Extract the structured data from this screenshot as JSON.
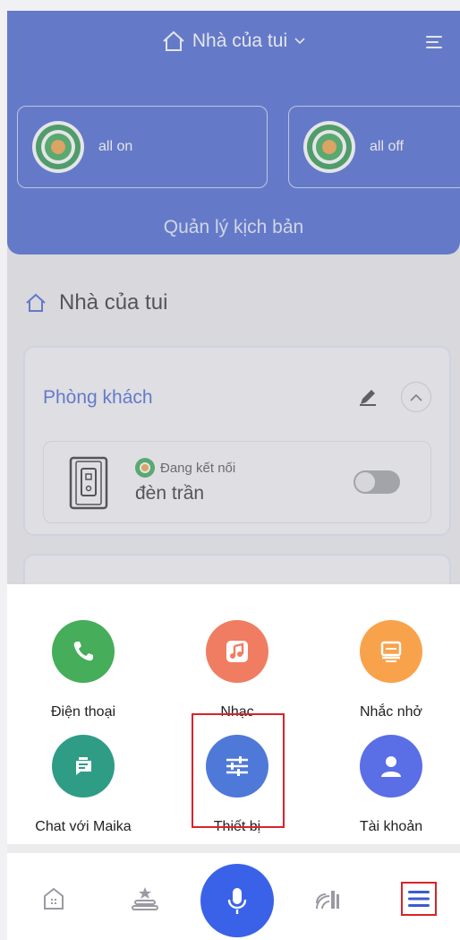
{
  "header": {
    "home_name": "Nhà của tui",
    "scenes": [
      {
        "label": "all on"
      },
      {
        "label": "all off"
      }
    ],
    "manage_label": "Quản lý kịch bản"
  },
  "home_section": {
    "title": "Nhà của tui"
  },
  "rooms": [
    {
      "name": "Phòng khách",
      "devices": [
        {
          "status": "Đang kết nối",
          "name": "đèn trần",
          "on": false
        }
      ]
    }
  ],
  "menu_sheet": {
    "items": [
      {
        "label": "Điện thoại",
        "icon": "phone-icon",
        "color": "#46ad5a"
      },
      {
        "label": "Nhạc",
        "icon": "music-icon",
        "color": "#f07d62"
      },
      {
        "label": "Nhắc nhở",
        "icon": "reminder-icon",
        "color": "#f8a34c"
      },
      {
        "label": "Chat với Maika",
        "icon": "chat-robot-icon",
        "color": "#2f9c86"
      },
      {
        "label": "Thiết bị",
        "icon": "sliders-icon",
        "color": "#4e79d8"
      },
      {
        "label": "Tài khoản",
        "icon": "account-icon",
        "color": "#5a6ee6"
      }
    ]
  },
  "bottom_nav": {
    "items": [
      "home-icon",
      "scene-icon",
      "voice-mic-icon",
      "signal-icon",
      "menu-icon"
    ]
  },
  "colors": {
    "header": "#3a5bd0",
    "mic": "#3a62e8",
    "highlight": "#d8232a"
  }
}
